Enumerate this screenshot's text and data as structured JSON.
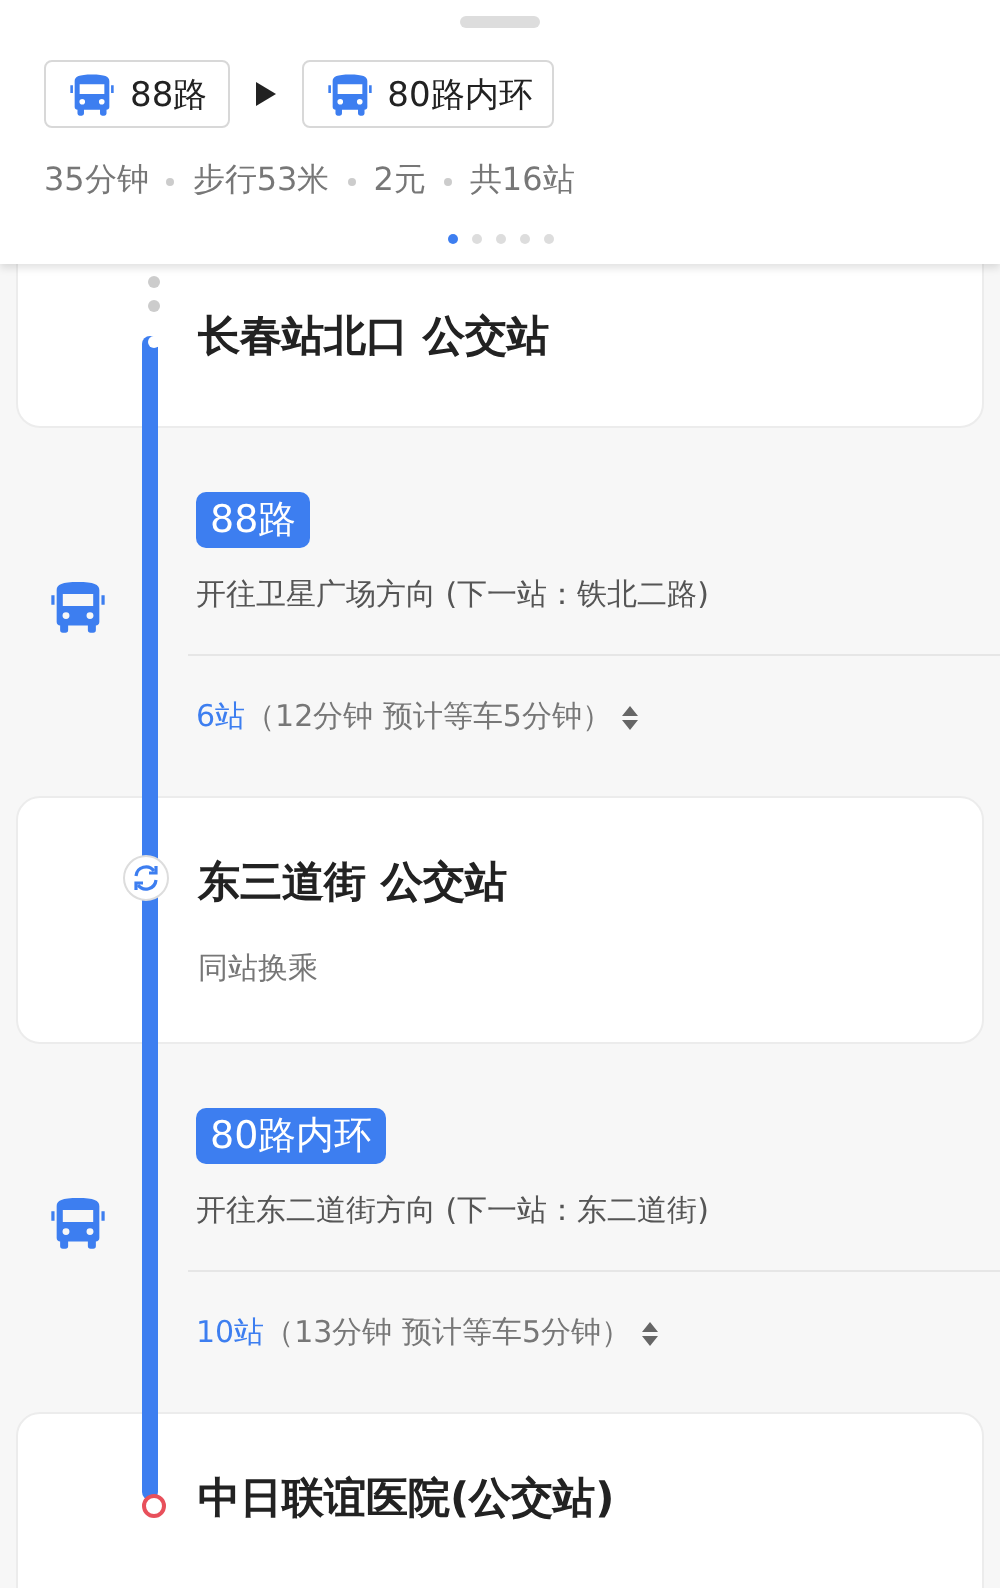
{
  "summary": {
    "lines": [
      {
        "name": "88路"
      },
      {
        "name": "80路内环"
      }
    ],
    "stats": [
      "35分钟",
      "步行53米",
      "2元",
      "共16站"
    ],
    "pages": [
      {
        "selected": true
      },
      {
        "selected": false
      },
      {
        "selected": false
      },
      {
        "selected": false
      },
      {
        "selected": false
      }
    ]
  },
  "steps": [
    {
      "kind": "origin",
      "name": "长春站北口 公交站"
    },
    {
      "kind": "ride",
      "line": "88路",
      "direction": "开往卫星广场方向 (下一站：铁北二路)",
      "stops": "6站",
      "duration": "（12分钟 预计等车5分钟）"
    },
    {
      "kind": "transfer",
      "name": "东三道街 公交站",
      "note": "同站换乘"
    },
    {
      "kind": "ride",
      "line": "80路内环",
      "direction": "开往东二道街方向 (下一站：东二道街)",
      "stops": "10站",
      "duration": "（13分钟 预计等车5分钟）"
    },
    {
      "kind": "destination",
      "name": "中日联谊医院(公交站)"
    }
  ]
}
